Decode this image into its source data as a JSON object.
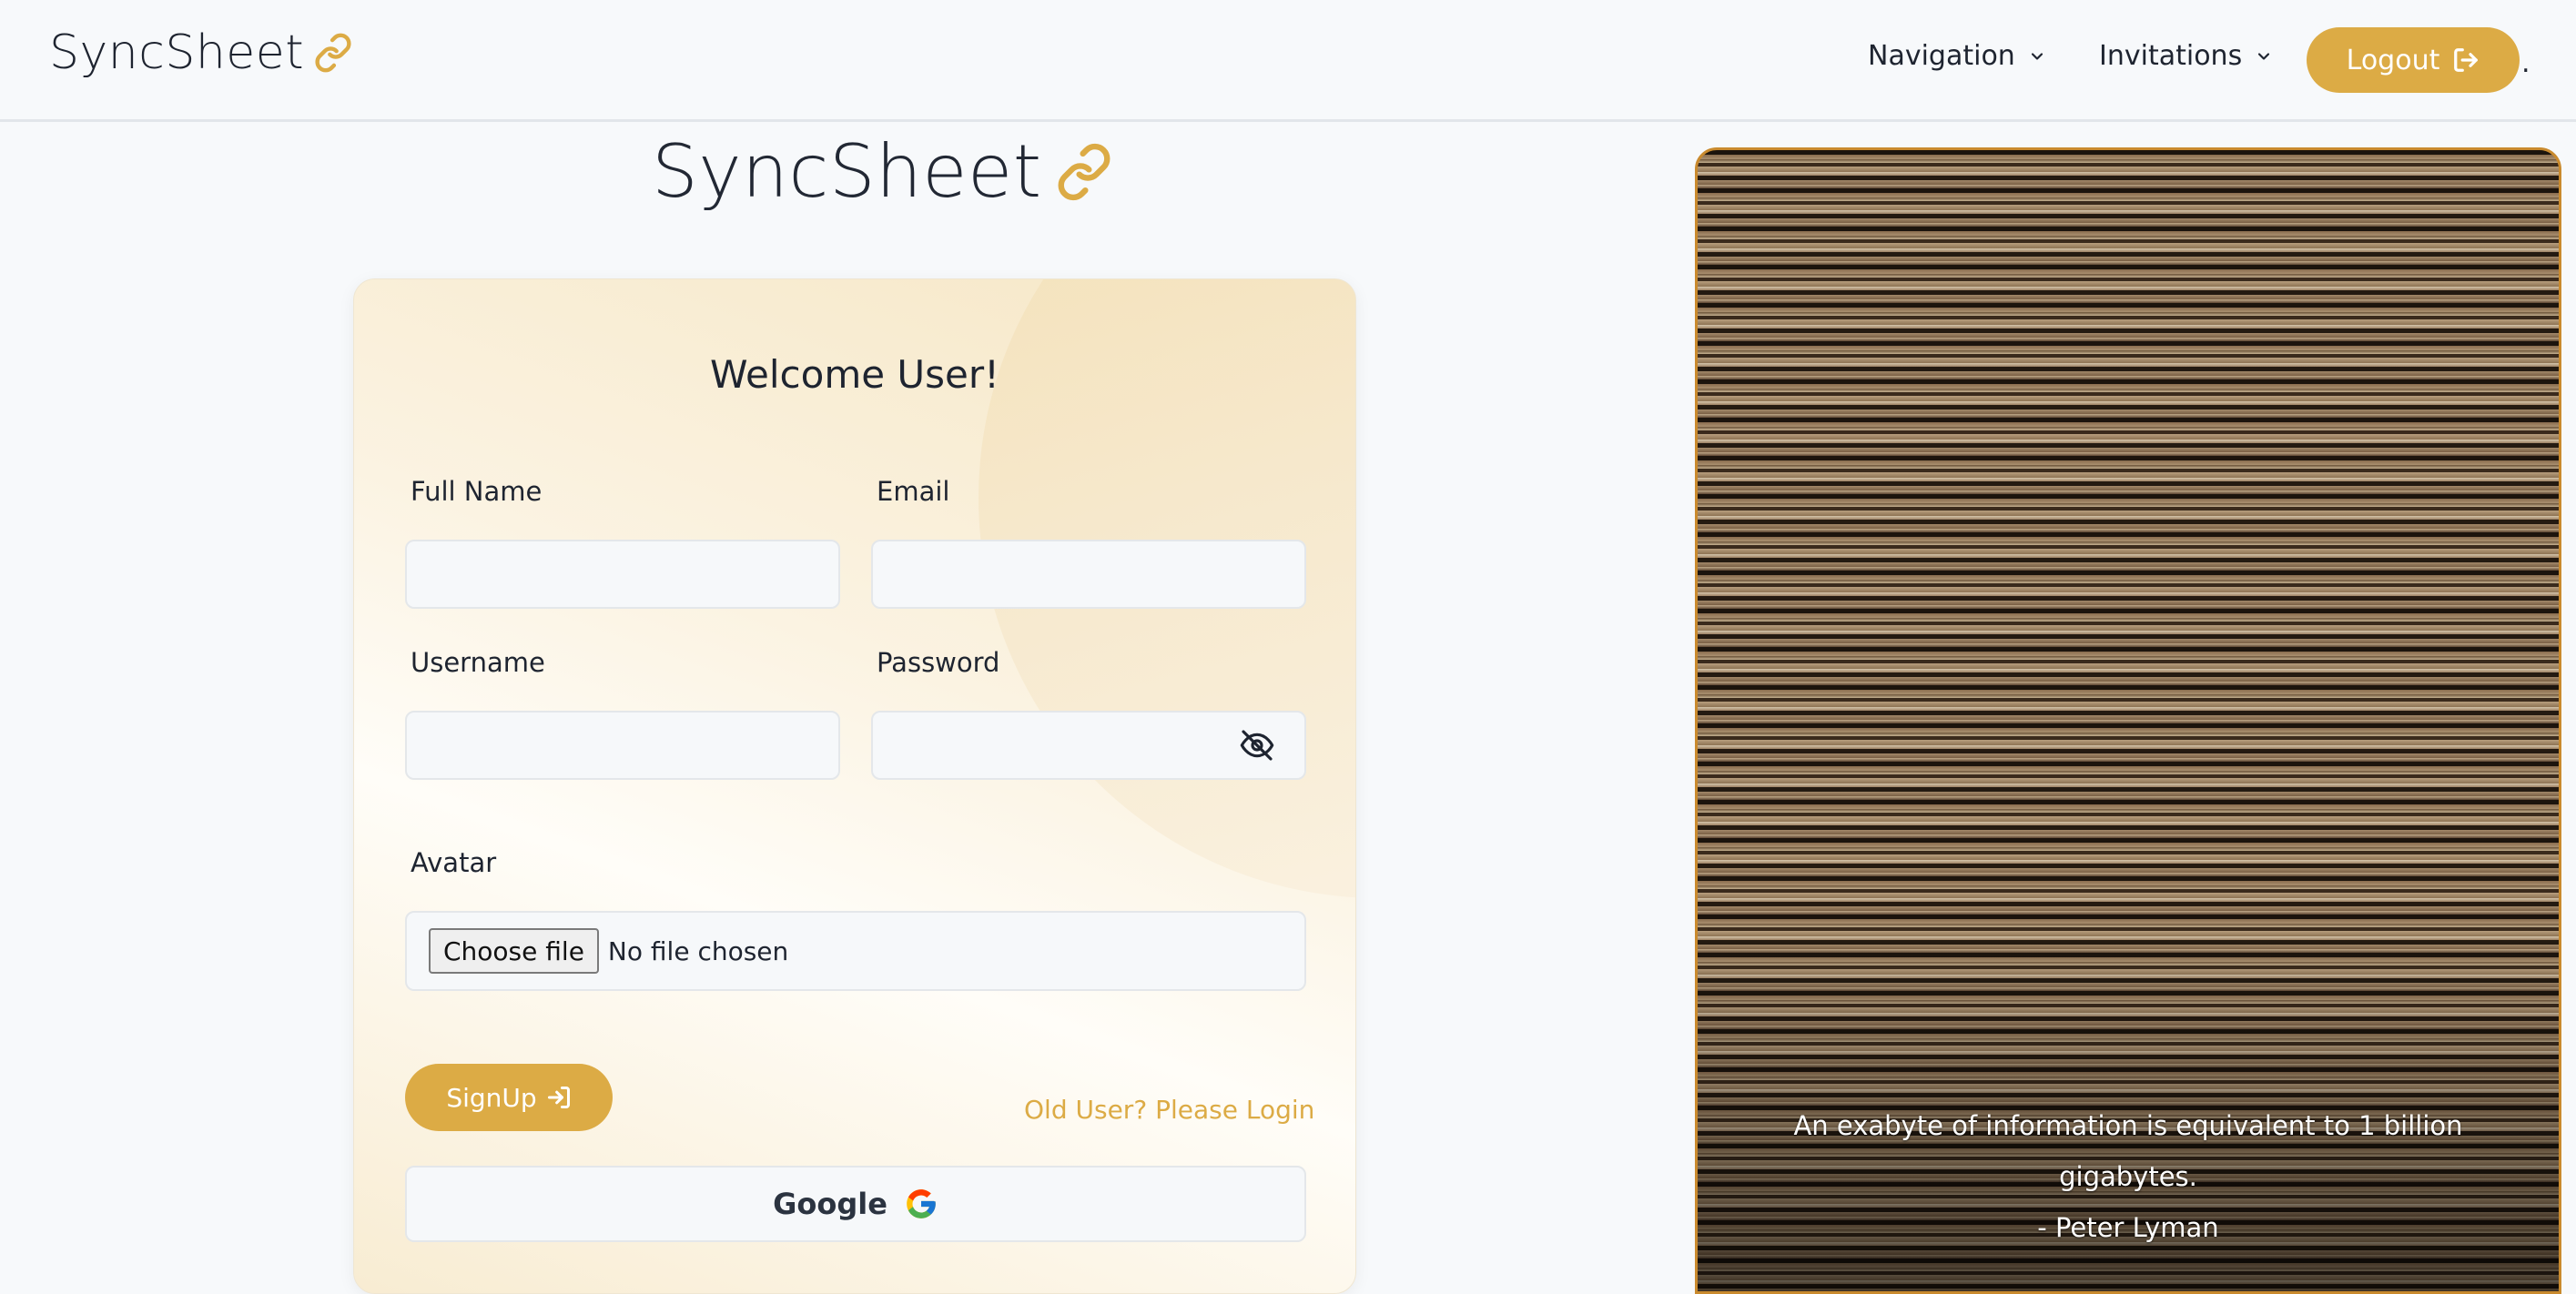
{
  "navbar": {
    "brand": "SyncSheet",
    "navigation_label": "Navigation",
    "invitations_label": "Invitations",
    "logout_label": "Logout",
    "trailing_dot": "."
  },
  "hero": {
    "title": "SyncSheet"
  },
  "form": {
    "heading": "Welcome User!",
    "full_name_label": "Full Name",
    "email_label": "Email",
    "username_label": "Username",
    "password_label": "Password",
    "avatar_label": "Avatar",
    "full_name_value": "",
    "email_value": "",
    "username_value": "",
    "password_value": "",
    "choose_file_label": "Choose file",
    "no_file_text": "No file chosen",
    "signup_label": "SignUp",
    "login_link": "Old User? Please Login",
    "google_label": "Google"
  },
  "quote": {
    "line": "An exabyte of information is equivalent to 1 billion gigabytes.",
    "author": "- Peter Lyman"
  },
  "icons": {
    "brand": "link-icon",
    "dropdown": "chevron-down-icon",
    "logout": "sign-out-icon",
    "password_toggle": "eye-slash-icon",
    "signup": "sign-in-icon",
    "google": "google-g-icon"
  },
  "colors": {
    "accent": "#dcab45",
    "background": "#f7f9fb",
    "text": "#1e2430",
    "image_border": "#c98a2e"
  }
}
